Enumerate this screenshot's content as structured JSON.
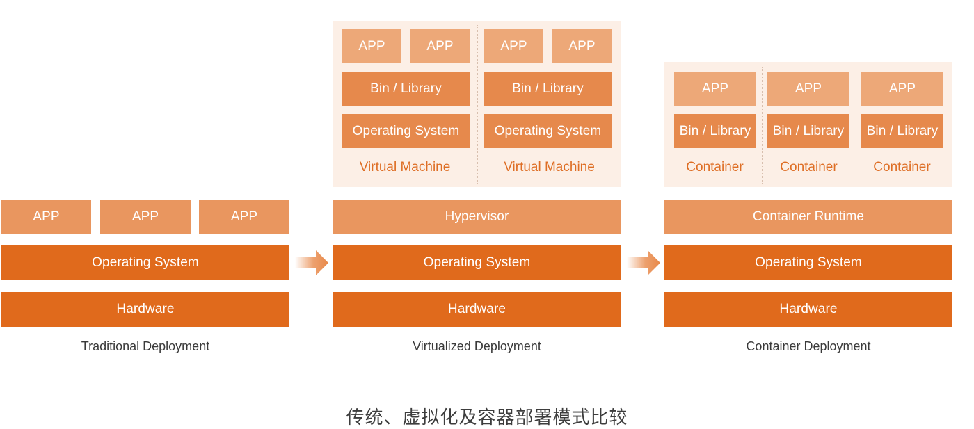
{
  "title": "传统、虚拟化及容器部署模式比较",
  "colors": {
    "app": "#e9965f",
    "app_light": "#eda878",
    "layer_mid": "#e6894c",
    "layer_dark": "#e06a1c",
    "panel_bg": "#fcefe6",
    "label_orange": "#de6e25",
    "caption_text": "#3a3a3a"
  },
  "traditional": {
    "caption": "Traditional Deployment",
    "apps": [
      "APP",
      "APP",
      "APP"
    ],
    "os": "Operating System",
    "hardware": "Hardware"
  },
  "virtualized": {
    "caption": "Virtualized Deployment",
    "vms": [
      {
        "apps": [
          "APP",
          "APP"
        ],
        "bin": "Bin / Library",
        "os": "Operating System",
        "label": "Virtual Machine"
      },
      {
        "apps": [
          "APP",
          "APP"
        ],
        "bin": "Bin / Library",
        "os": "Operating System",
        "label": "Virtual Machine"
      }
    ],
    "hypervisor": "Hypervisor",
    "os": "Operating System",
    "hardware": "Hardware"
  },
  "container": {
    "caption": "Container Deployment",
    "containers": [
      {
        "app": "APP",
        "bin": "Bin / Library",
        "label": "Container"
      },
      {
        "app": "APP",
        "bin": "Bin / Library",
        "label": "Container"
      },
      {
        "app": "APP",
        "bin": "Bin / Library",
        "label": "Container"
      }
    ],
    "runtime": "Container Runtime",
    "os": "Operating System",
    "hardware": "Hardware"
  },
  "arrows": [
    "arrow-right",
    "arrow-right"
  ]
}
